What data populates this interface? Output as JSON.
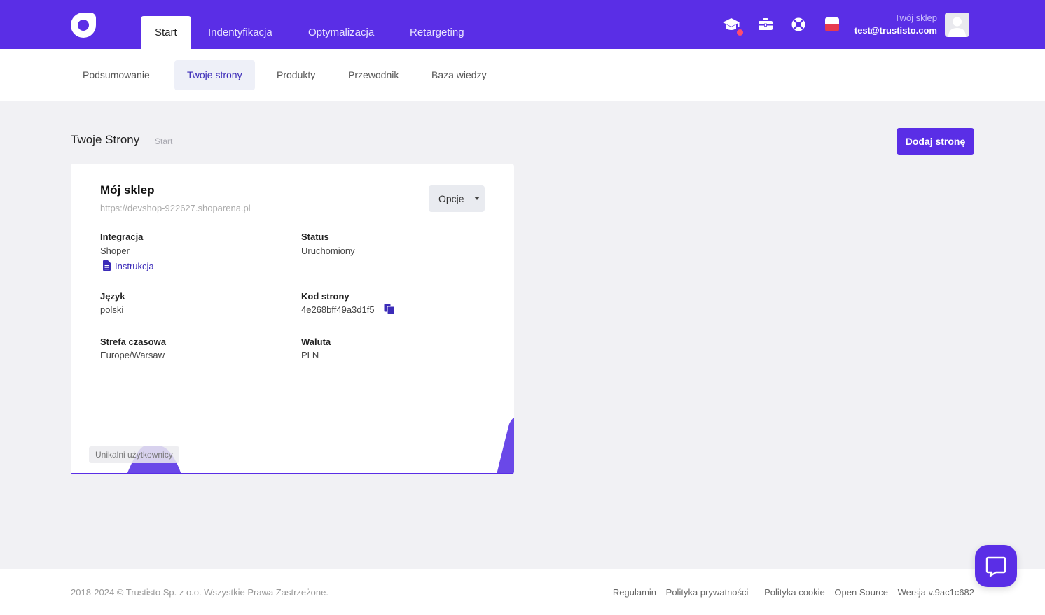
{
  "topbar": {
    "tabs": [
      "Start",
      "Indentyfikacja",
      "Optymalizacja",
      "Retargeting"
    ],
    "user": {
      "shop": "Twój sklep",
      "email": "test@trustisto.com"
    }
  },
  "subnav": {
    "tabs": [
      "Podsumowanie",
      "Twoje strony",
      "Produkty",
      "Przewodnik",
      "Baza wiedzy"
    ]
  },
  "page": {
    "title": "Twoje Strony",
    "breadcrumb": "Start",
    "add_button": "Dodaj stronę"
  },
  "card": {
    "title": "Mój sklep",
    "url": "https://devshop-922627.shoparena.pl",
    "options_button": "Opcje",
    "fields": {
      "integration": {
        "label": "Integracja",
        "value": "Shoper",
        "link": "Instrukcja"
      },
      "status": {
        "label": "Status",
        "value": "Uruchomiony"
      },
      "language": {
        "label": "Język",
        "value": "polski"
      },
      "site_code": {
        "label": "Kod strony",
        "value": "4e268bff49a3d1f5"
      },
      "timezone": {
        "label": "Strefa czasowa",
        "value": "Europe/Warsaw"
      },
      "currency": {
        "label": "Waluta",
        "value": "PLN"
      }
    },
    "chart_label": "Unikalni użytkownicy"
  },
  "footer": {
    "copyright": "2018-2024 © Trustisto Sp. z o.o. Wszystkie Prawa Zastrzeżone.",
    "links": [
      "Regulamin",
      "Polityka prywatności",
      "Polityka cookie",
      "Open Source"
    ],
    "version": "Wersja v.9ac1c682"
  },
  "colors": {
    "brand": "#5a2ee6",
    "link": "#3b2bb8",
    "notification": "#ff4d6d"
  },
  "icons": [
    "graduation-cap-icon",
    "briefcase-icon",
    "lifebuoy-icon",
    "flag-pl-icon",
    "avatar-icon",
    "document-icon",
    "copy-icon",
    "chat-icon"
  ]
}
